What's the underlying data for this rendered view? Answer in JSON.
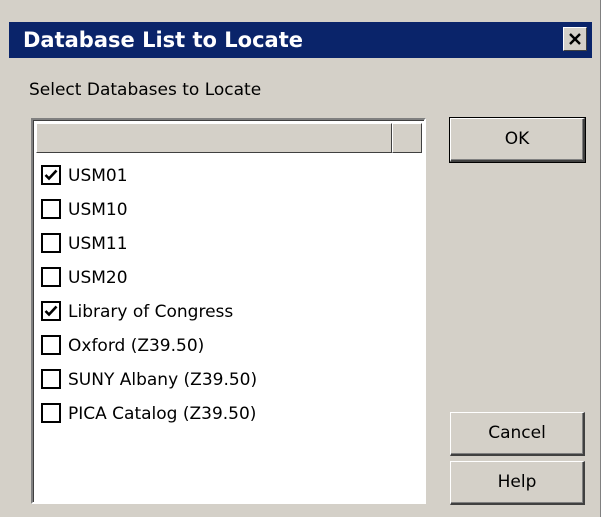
{
  "dialog": {
    "title": "Database List to Locate",
    "close_icon": "close-icon"
  },
  "section_label": "Select Databases to Locate",
  "databases": [
    {
      "label": "USM01",
      "checked": true
    },
    {
      "label": "USM10",
      "checked": false
    },
    {
      "label": "USM11",
      "checked": false
    },
    {
      "label": "USM20",
      "checked": false
    },
    {
      "label": "Library of Congress",
      "checked": true
    },
    {
      "label": "Oxford (Z39.50)",
      "checked": false
    },
    {
      "label": "SUNY Albany (Z39.50)",
      "checked": false
    },
    {
      "label": "PICA Catalog (Z39.50)",
      "checked": false
    }
  ],
  "buttons": {
    "ok": "OK",
    "cancel": "Cancel",
    "help": "Help"
  },
  "colors": {
    "title_bar": "#0a246a",
    "dialog_bg": "#d4d0c8",
    "list_bg": "#ffffff"
  }
}
